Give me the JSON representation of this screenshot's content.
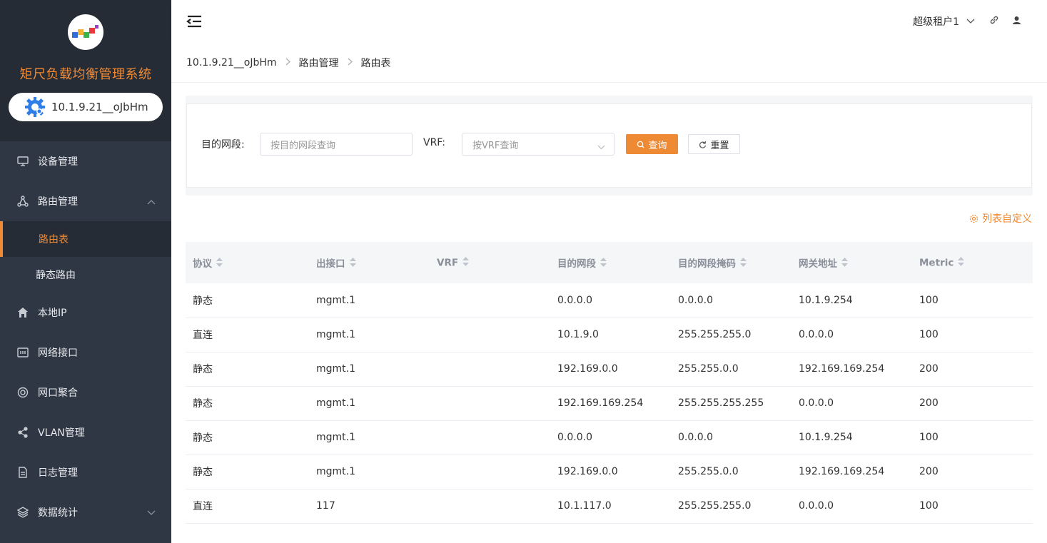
{
  "sidebar": {
    "app_title": "矩尺负载均衡管理系统",
    "tenant": "10.1.9.21__oJbHm",
    "menu": [
      {
        "label": "设备管理"
      },
      {
        "label": "路由管理"
      },
      {
        "sub": [
          {
            "label": "路由表"
          },
          {
            "label": "静态路由"
          }
        ]
      },
      {
        "label": "本地IP"
      },
      {
        "label": "网络接口"
      },
      {
        "label": "网口聚合"
      },
      {
        "label": "VLAN管理"
      },
      {
        "label": "日志管理"
      },
      {
        "label": "数据统计"
      }
    ]
  },
  "header": {
    "user": "超级租户1"
  },
  "breadcrumb": [
    "10.1.9.21__oJbHm",
    "路由管理",
    "路由表"
  ],
  "search": {
    "dest_label": "目的网段:",
    "dest_placeholder": "按目的网段查询",
    "vrf_label": "VRF:",
    "vrf_placeholder": "按VRF查询",
    "query_btn": "查询",
    "reset_btn": "重置"
  },
  "customize_label": "列表自定义",
  "colors": {
    "accent": "#ef8a34",
    "sidebar": "#2f3744"
  },
  "table": {
    "columns": [
      "协议",
      "出接口",
      "VRF",
      "目的网段",
      "目的网段掩码",
      "网关地址",
      "Metric"
    ],
    "rows": [
      [
        "静态",
        "mgmt.1",
        "",
        "0.0.0.0",
        "0.0.0.0",
        "10.1.9.254",
        "100"
      ],
      [
        "直连",
        "mgmt.1",
        "",
        "10.1.9.0",
        "255.255.255.0",
        "0.0.0.0",
        "100"
      ],
      [
        "静态",
        "mgmt.1",
        "",
        "192.169.0.0",
        "255.255.0.0",
        "192.169.169.254",
        "200"
      ],
      [
        "静态",
        "mgmt.1",
        "",
        "192.169.169.254",
        "255.255.255.255",
        "0.0.0.0",
        "200"
      ],
      [
        "静态",
        "mgmt.1",
        "",
        "0.0.0.0",
        "0.0.0.0",
        "10.1.9.254",
        "100"
      ],
      [
        "静态",
        "mgmt.1",
        "",
        "192.169.0.0",
        "255.255.0.0",
        "192.169.169.254",
        "200"
      ],
      [
        "直连",
        "117",
        "",
        "10.1.117.0",
        "255.255.255.0",
        "0.0.0.0",
        "100"
      ]
    ]
  }
}
